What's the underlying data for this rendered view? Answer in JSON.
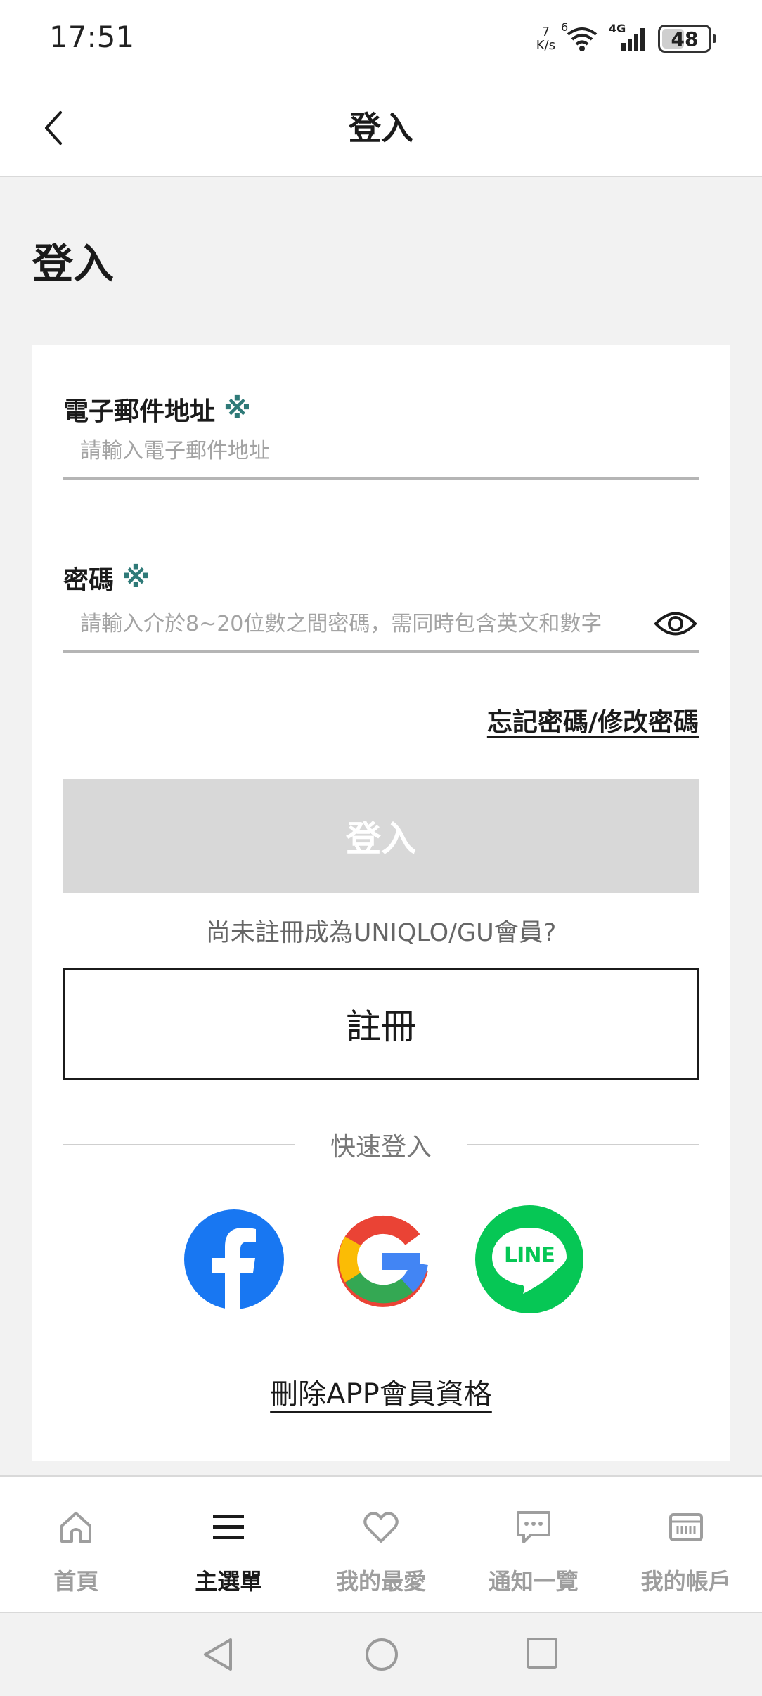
{
  "status_bar": {
    "time": "17:51",
    "net_speed_value": "7",
    "net_speed_unit": "K/s",
    "wifi_badge": "6",
    "network_type": "4G",
    "battery_level": "48",
    "battery_fraction": 0.48
  },
  "app_bar": {
    "title": "登入",
    "back_icon": "chevron-left-icon"
  },
  "page": {
    "heading": "登入"
  },
  "form": {
    "email_label": "電子郵件地址",
    "email_required_mark": "※",
    "email_placeholder": "請輸入電子郵件地址",
    "email_value": "",
    "password_label": "密碼",
    "password_required_mark": "※",
    "password_placeholder": "請輸入介於8~20位數之間密碼，需同時包含英文和數字",
    "password_value": "",
    "forgot_link": "忘記密碼/修改密碼",
    "login_button": "登入",
    "register_prompt": "尚未註冊成為UNIQLO/GU會員?",
    "register_button": "註冊",
    "quick_login_label": "快速登入",
    "delete_membership_link": "刪除APP會員資格"
  },
  "social": {
    "line_text": "LINE",
    "facebook_color": "#1877f2",
    "line_color": "#06c755"
  },
  "colors": {
    "required_mark": "#2f7a78",
    "login_disabled_bg": "#d8d8d8",
    "nav_inactive": "#9e9e9e",
    "nav_active": "#1b1b1b"
  },
  "bottom_nav": {
    "items": [
      {
        "label": "首頁",
        "icon": "home-icon",
        "active": false
      },
      {
        "label": "主選單",
        "icon": "menu-icon",
        "active": true
      },
      {
        "label": "我的最愛",
        "icon": "heart-icon",
        "active": false
      },
      {
        "label": "通知一覽",
        "icon": "chat-bubble-icon",
        "active": false
      },
      {
        "label": "我的帳戶",
        "icon": "membership-card-icon",
        "active": false
      }
    ]
  }
}
